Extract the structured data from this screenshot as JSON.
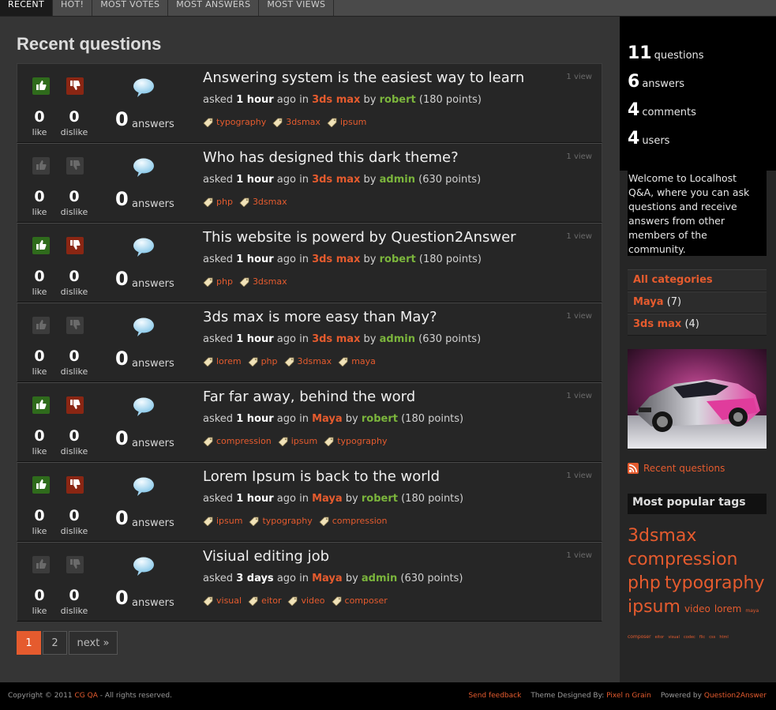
{
  "nav": {
    "tabs": [
      {
        "label": "RECENT",
        "active": true
      },
      {
        "label": "HOT!"
      },
      {
        "label": "MOST VOTES"
      },
      {
        "label": "MOST ANSWERS"
      },
      {
        "label": "MOST VIEWS"
      }
    ]
  },
  "main": {
    "title": "Recent questions",
    "questions": [
      {
        "title": "Answering system is the easiest way to learn",
        "like": "0",
        "dislike": "0",
        "answers": "0",
        "answers_label": "answers",
        "like_label": "like",
        "dislike_label": "dislike",
        "asked": "asked",
        "when": "1 hour",
        "ago_in": "ago in",
        "category": "3ds max",
        "by": "by",
        "user": "robert",
        "points": "(180 points)",
        "views": "1 view",
        "tags": [
          "typography",
          "3dsmax",
          "ipsum"
        ],
        "voted": true
      },
      {
        "title": "Who has designed this dark theme?",
        "like": "0",
        "dislike": "0",
        "answers": "0",
        "answers_label": "answers",
        "like_label": "like",
        "dislike_label": "dislike",
        "asked": "asked",
        "when": "1 hour",
        "ago_in": "ago in",
        "category": "3ds max",
        "by": "by",
        "user": "admin",
        "points": "(630 points)",
        "views": "1 view",
        "tags": [
          "php",
          "3dsmax"
        ],
        "voted": false
      },
      {
        "title": "This website is powerd by Question2Answer",
        "like": "0",
        "dislike": "0",
        "answers": "0",
        "answers_label": "answers",
        "like_label": "like",
        "dislike_label": "dislike",
        "asked": "asked",
        "when": "1 hour",
        "ago_in": "ago in",
        "category": "3ds max",
        "by": "by",
        "user": "robert",
        "points": "(180 points)",
        "views": "1 view",
        "tags": [
          "php",
          "3dsmax"
        ],
        "voted": true
      },
      {
        "title": "3ds max is more easy than May?",
        "like": "0",
        "dislike": "0",
        "answers": "0",
        "answers_label": "answers",
        "like_label": "like",
        "dislike_label": "dislike",
        "asked": "asked",
        "when": "1 hour",
        "ago_in": "ago in",
        "category": "3ds max",
        "by": "by",
        "user": "admin",
        "points": "(630 points)",
        "views": "1 view",
        "tags": [
          "lorem",
          "php",
          "3dsmax",
          "maya"
        ],
        "voted": false
      },
      {
        "title": "Far far away, behind the word",
        "like": "0",
        "dislike": "0",
        "answers": "0",
        "answers_label": "answers",
        "like_label": "like",
        "dislike_label": "dislike",
        "asked": "asked",
        "when": "1 hour",
        "ago_in": "ago in",
        "category": "Maya",
        "by": "by",
        "user": "robert",
        "points": "(180 points)",
        "views": "1 view",
        "tags": [
          "compression",
          "ipsum",
          "typography"
        ],
        "voted": true
      },
      {
        "title": "Lorem Ipsum is back to the world",
        "like": "0",
        "dislike": "0",
        "answers": "0",
        "answers_label": "answers",
        "like_label": "like",
        "dislike_label": "dislike",
        "asked": "asked",
        "when": "1 hour",
        "ago_in": "ago in",
        "category": "Maya",
        "by": "by",
        "user": "robert",
        "points": "(180 points)",
        "views": "1 view",
        "tags": [
          "ipsum",
          "typography",
          "compression"
        ],
        "voted": true
      },
      {
        "title": "Visiual editing job",
        "like": "0",
        "dislike": "0",
        "answers": "0",
        "answers_label": "answers",
        "like_label": "like",
        "dislike_label": "dislike",
        "asked": "asked",
        "when": "3 days",
        "ago_in": "ago in",
        "category": "Maya",
        "by": "by",
        "user": "admin",
        "points": "(630 points)",
        "views": "1 view",
        "tags": [
          "visual",
          "eitor",
          "video",
          "composer"
        ],
        "voted": false
      }
    ],
    "pager": {
      "current": "1",
      "page2": "2",
      "next": "next »"
    }
  },
  "sidebar": {
    "stats": [
      {
        "n": "11",
        "label": "questions"
      },
      {
        "n": "6",
        "label": "answers"
      },
      {
        "n": "4",
        "label": "comments"
      },
      {
        "n": "4",
        "label": "users"
      }
    ],
    "welcome": "Welcome to Localhost Q&A, where you can ask questions and receive answers from other members of the community.",
    "categories": [
      {
        "label": "All categories",
        "count": ""
      },
      {
        "label": "Maya",
        "count": "(7)"
      },
      {
        "label": "3ds max",
        "count": "(4)"
      }
    ],
    "feed_label": "Recent questions",
    "tags_title": "Most popular tags",
    "tag_cloud": [
      {
        "label": "3dsmax",
        "size": 22
      },
      {
        "label": "compression",
        "size": 22
      },
      {
        "label": "php",
        "size": 22
      },
      {
        "label": "typography",
        "size": 22
      },
      {
        "label": "ipsum",
        "size": 22
      },
      {
        "label": "video",
        "size": 12
      },
      {
        "label": "lorem",
        "size": 12
      },
      {
        "label": "maya",
        "size": 6
      },
      {
        "label": "composer",
        "size": 6
      },
      {
        "label": "eitor",
        "size": 5
      },
      {
        "label": "visual",
        "size": 5
      },
      {
        "label": "codec",
        "size": 5
      },
      {
        "label": "flic",
        "size": 5
      },
      {
        "label": "css",
        "size": 5
      },
      {
        "label": "html",
        "size": 5
      }
    ]
  },
  "footer": {
    "copyright_prefix": "Copyright © 2011",
    "site": "CG QA",
    "rights": "- All rights reserved.",
    "feedback": "Send feedback",
    "designed_by_label": "Theme Designed By:",
    "designer": "Pixel n Grain",
    "powered_label": "Powered by",
    "powered": "Question2Answer"
  },
  "colors": {
    "accent": "#e55b2e",
    "user": "#7bb53c",
    "like_on": "#2f6b1c",
    "dislike_on": "#8a2613"
  }
}
